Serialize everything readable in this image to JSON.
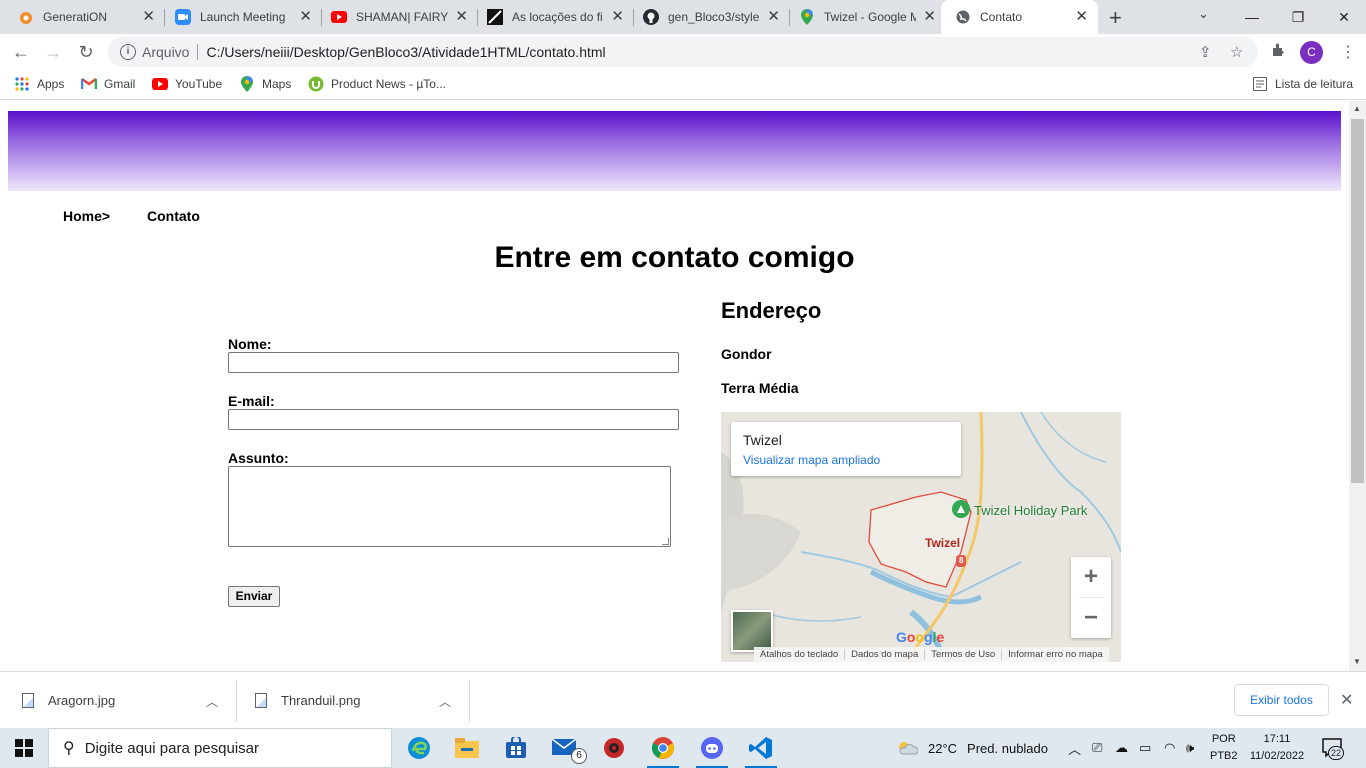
{
  "browser": {
    "tabs": [
      {
        "title": "GeneratiON",
        "icon": "generation-icon"
      },
      {
        "title": "Launch Meeting",
        "icon": "zoom-icon"
      },
      {
        "title": "SHAMAN| FAIRY",
        "icon": "youtube-icon"
      },
      {
        "title": "As locações do fi",
        "icon": "article-icon"
      },
      {
        "title": "gen_Bloco3/style",
        "icon": "github-icon"
      },
      {
        "title": "Twizel - Google M",
        "icon": "maps-icon"
      },
      {
        "title": "Contato",
        "icon": "globe-icon"
      }
    ],
    "active_tab": 6,
    "omnibox": {
      "protocol_label": "Arquivo",
      "url": "C:/Users/neiii/Desktop/GenBloco3/Atividade1HTML/contato.html"
    },
    "profile_initial": "C",
    "bookmarks": [
      {
        "label": "Apps",
        "icon": "apps-grid-icon"
      },
      {
        "label": "Gmail",
        "icon": "gmail-icon"
      },
      {
        "label": "YouTube",
        "icon": "youtube-icon"
      },
      {
        "label": "Maps",
        "icon": "maps-icon"
      },
      {
        "label": "Product News - µTo...",
        "icon": "utorrent-icon"
      }
    ],
    "reading_list_label": "Lista de leitura"
  },
  "page": {
    "breadcrumbs": [
      {
        "label": "Home>"
      },
      {
        "label": "Contato"
      }
    ],
    "title": "Entre em contato comigo",
    "form": {
      "name_label": "Nome:",
      "email_label": "E-mail:",
      "subject_label": "Assunto:",
      "submit_label": "Enviar"
    },
    "address": {
      "heading": "Endereço",
      "line1": "Gondor",
      "line2": "Terra Média"
    },
    "map": {
      "place_name": "Twizel",
      "view_larger_link": "Visualizar mapa ampliado",
      "poi_label": "Twizel Holiday Park",
      "town_label": "Twizel",
      "road_badge": "8",
      "zoom_in": "+",
      "zoom_out": "−",
      "logo_text": "Google",
      "footer": [
        "Atalhos do teclado",
        "Dados do mapa",
        "Termos de Uso",
        "Informar erro no mapa"
      ]
    }
  },
  "downloads": {
    "items": [
      {
        "filename": "Aragorn.jpg"
      },
      {
        "filename": "Thranduil.png"
      }
    ],
    "show_all_label": "Exibir todos"
  },
  "taskbar": {
    "search_placeholder": "Digite aqui para pesquisar",
    "apps": [
      "edge-icon",
      "file-explorer-icon",
      "store-icon",
      "mail-icon",
      "antivirus-icon",
      "chrome-icon",
      "discord-icon",
      "vscode-icon"
    ],
    "mail_badge": "6",
    "weather": {
      "temp": "22°C",
      "condition": "Pred. nublado"
    },
    "lang": {
      "line1": "POR",
      "line2": "PTB2"
    },
    "clock": {
      "time": "17:11",
      "date": "11/02/2022"
    },
    "notification_count": "22"
  }
}
